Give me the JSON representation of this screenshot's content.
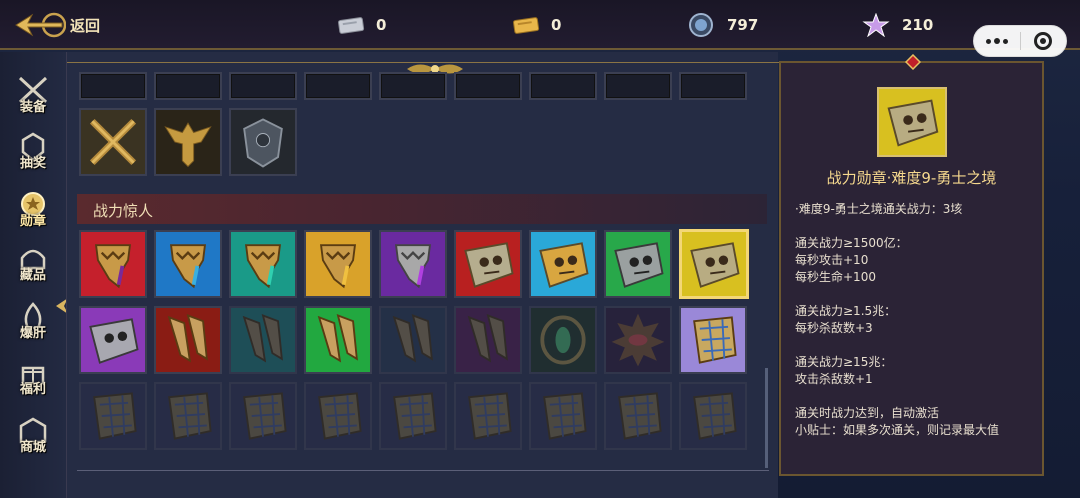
{
  "topbar": {
    "back_label": "返回",
    "resources": [
      {
        "icon": "silver-ticket-icon",
        "value": "0"
      },
      {
        "icon": "gold-ticket-icon",
        "value": "0"
      },
      {
        "icon": "crystal-coin-icon",
        "value": "797"
      },
      {
        "icon": "star-gem-icon",
        "value": "210"
      }
    ]
  },
  "sidebar": {
    "items": [
      {
        "label": "装备",
        "icon": "crossed-swords-icon"
      },
      {
        "label": "抽奖",
        "icon": "crest-icon"
      },
      {
        "label": "勋章",
        "icon": "medal-icon",
        "active": true
      },
      {
        "label": "藏品",
        "icon": "helmet-icon"
      },
      {
        "label": "爆肝",
        "icon": "flame-icon"
      },
      {
        "label": "福利",
        "icon": "gift-icon"
      },
      {
        "label": "商城",
        "icon": "shop-icon"
      }
    ]
  },
  "panel": {
    "section_title": "战力惊人"
  },
  "detail": {
    "title": "战力勋章·难度9-勇士之境",
    "lines": [
      "·难度9-勇士之境通关战力：3垓",
      "",
      "通关战力≥1500亿：",
      "每秒攻击+10",
      "每秒生命+100",
      "",
      "通关战力≥1.5兆：",
      "每秒杀敌数+3",
      "",
      "通关战力≥15兆：",
      "攻击杀敌数+1",
      "",
      "通关时战力达到，自动激活",
      "小贴士：如果多次通关，则记录最大值"
    ]
  },
  "colors": {
    "gold_border": "#f3d777",
    "section_red": "#5a2a2e",
    "panel_bg": "#252c44"
  }
}
